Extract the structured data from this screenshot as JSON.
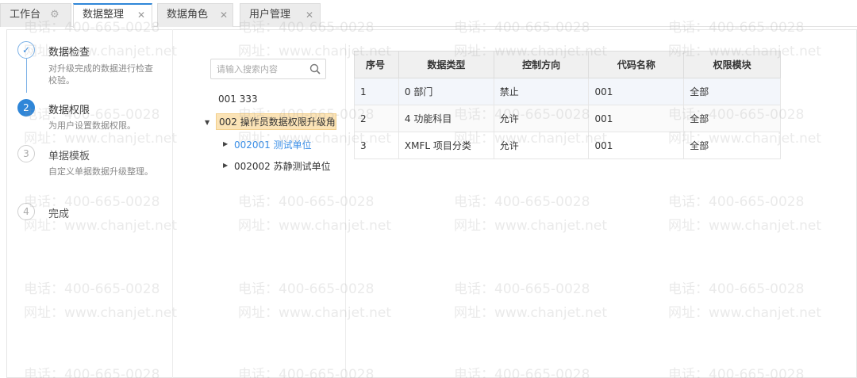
{
  "tabs": [
    {
      "label": "工作台",
      "active": false
    },
    {
      "label": "数据整理",
      "active": true
    },
    {
      "label": "数据角色",
      "active": false
    },
    {
      "label": "用户管理",
      "active": false
    }
  ],
  "steps": [
    {
      "number": "✓",
      "title": "数据检查",
      "desc": "对升级完成的数据进行检查校验。",
      "state": "done"
    },
    {
      "number": "2",
      "title": "数据权限",
      "desc": "为用户设置数据权限。",
      "state": "current"
    },
    {
      "number": "3",
      "title": "单据模板",
      "desc": "自定义单据数据升级整理。",
      "state": "todo"
    },
    {
      "number": "4",
      "title": "完成",
      "desc": "",
      "state": "todo"
    }
  ],
  "tree": {
    "search_placeholder": "请输入搜索内容",
    "nodes": [
      {
        "label": "001 333"
      },
      {
        "label": "002 操作员数据权限升级角"
      },
      {
        "label": "002001 测试单位"
      },
      {
        "label": "002002 苏静测试单位"
      }
    ]
  },
  "table": {
    "columns": [
      "序号",
      "数据类型",
      "控制方向",
      "代码名称",
      "权限模块"
    ],
    "rows": [
      [
        "1",
        "0 部门",
        "禁止",
        "001",
        "全部"
      ],
      [
        "2",
        "4 功能科目",
        "允许",
        "001",
        "全部"
      ],
      [
        "3",
        "XMFL 项目分类",
        "允许",
        "001",
        "全部"
      ]
    ]
  },
  "watermark": {
    "phone": "电话：400-665-0028",
    "site": "网址：www.chanjet.net"
  },
  "colors": {
    "accent": "#2f86d8",
    "selected_bg": "#fbe3b6",
    "link": "#3a8ee6"
  }
}
